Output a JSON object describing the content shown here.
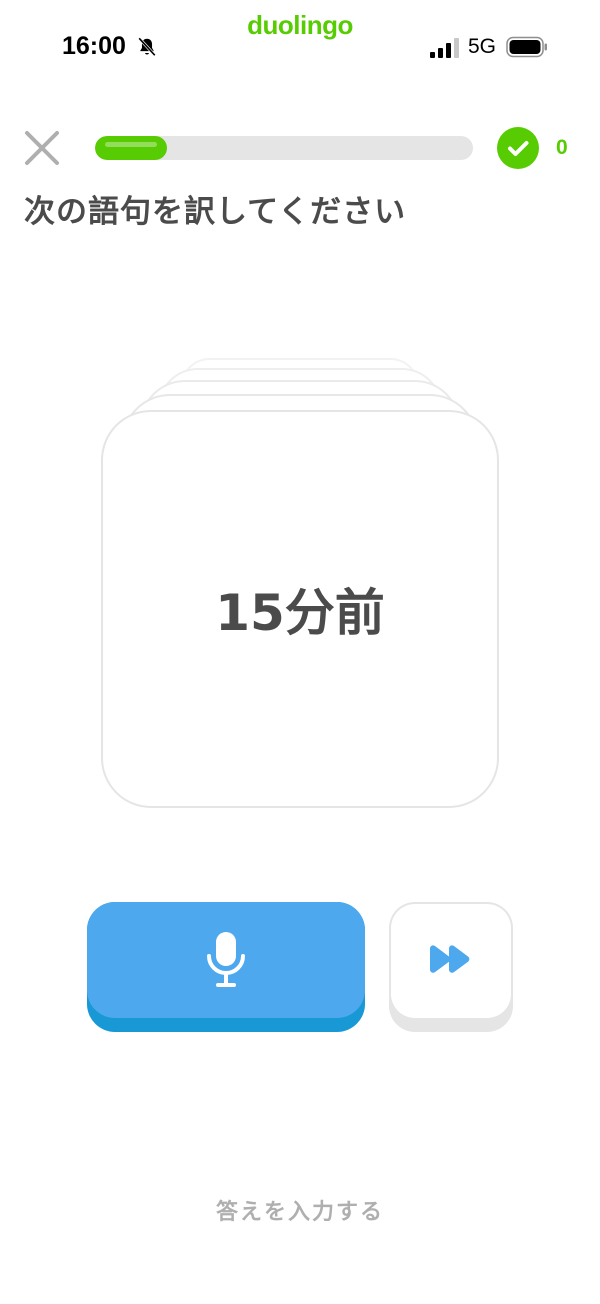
{
  "status_bar": {
    "app_name": "duolingo",
    "time": "16:00",
    "network": "5G"
  },
  "lesson": {
    "progress_fraction": 0.19,
    "correct_count": "0",
    "instruction": "次の語句を訳してください",
    "card_text": "15分前",
    "type_answer_label": "答えを入力する"
  },
  "colors": {
    "brand_green": "#58cc02",
    "mic_blue": "#4da8ee",
    "mic_blue_shadow": "#1899d6",
    "muted_gray": "#afafaf"
  },
  "icons": {
    "close": "close-icon",
    "mute": "bell-slash-icon",
    "check": "check-circle-icon",
    "mic": "microphone-icon",
    "skip": "fast-forward-icon"
  }
}
